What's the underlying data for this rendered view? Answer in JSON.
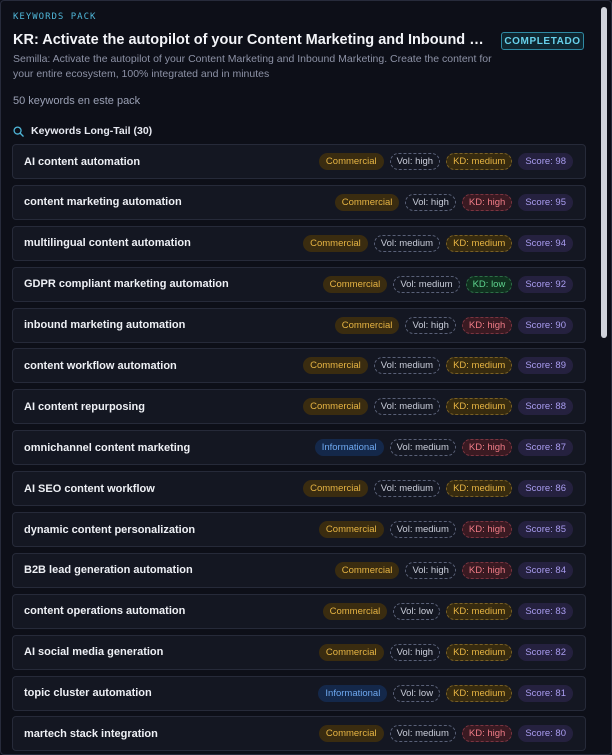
{
  "header": {
    "pack_label": "KEYWORDS PACK",
    "title": "KR: Activate the autopilot of your Content Marketing and Inbound Marketing. Create the content for your entire ecosystem, 100% integrated and in minutes",
    "status": "COMPLETADO",
    "description": "Semilla: Activate the autopilot of your Content Marketing and Inbound Marketing. Create the content for your entire ecosystem, 100% integrated and in minutes",
    "count_text": "50 keywords en este pack"
  },
  "section": {
    "icon": "search-icon",
    "title": "Keywords Long-Tail (30)"
  },
  "colors": {
    "accent": "#4fb6d8",
    "commercial": "#e6b443",
    "informational": "#6ea8f0",
    "kd_high": "#ef7b86",
    "kd_low": "#5ed48e",
    "score": "#a99cf0"
  },
  "keywords": [
    {
      "keyword": "AI content automation",
      "intent": "Commercial",
      "volume": "Vol: high",
      "kd": "KD: medium",
      "score": "Score: 98"
    },
    {
      "keyword": "content marketing automation",
      "intent": "Commercial",
      "volume": "Vol: high",
      "kd": "KD: high",
      "score": "Score: 95"
    },
    {
      "keyword": "multilingual content automation",
      "intent": "Commercial",
      "volume": "Vol: medium",
      "kd": "KD: medium",
      "score": "Score: 94"
    },
    {
      "keyword": "GDPR compliant marketing automation",
      "intent": "Commercial",
      "volume": "Vol: medium",
      "kd": "KD: low",
      "score": "Score: 92"
    },
    {
      "keyword": "inbound marketing automation",
      "intent": "Commercial",
      "volume": "Vol: high",
      "kd": "KD: high",
      "score": "Score: 90"
    },
    {
      "keyword": "content workflow automation",
      "intent": "Commercial",
      "volume": "Vol: medium",
      "kd": "KD: medium",
      "score": "Score: 89"
    },
    {
      "keyword": "AI content repurposing",
      "intent": "Commercial",
      "volume": "Vol: medium",
      "kd": "KD: medium",
      "score": "Score: 88"
    },
    {
      "keyword": "omnichannel content marketing",
      "intent": "Informational",
      "volume": "Vol: medium",
      "kd": "KD: high",
      "score": "Score: 87"
    },
    {
      "keyword": "AI SEO content workflow",
      "intent": "Commercial",
      "volume": "Vol: medium",
      "kd": "KD: medium",
      "score": "Score: 86"
    },
    {
      "keyword": "dynamic content personalization",
      "intent": "Commercial",
      "volume": "Vol: medium",
      "kd": "KD: high",
      "score": "Score: 85"
    },
    {
      "keyword": "B2B lead generation automation",
      "intent": "Commercial",
      "volume": "Vol: high",
      "kd": "KD: high",
      "score": "Score: 84"
    },
    {
      "keyword": "content operations automation",
      "intent": "Commercial",
      "volume": "Vol: low",
      "kd": "KD: medium",
      "score": "Score: 83"
    },
    {
      "keyword": "AI social media generation",
      "intent": "Commercial",
      "volume": "Vol: high",
      "kd": "KD: medium",
      "score": "Score: 82"
    },
    {
      "keyword": "topic cluster automation",
      "intent": "Informational",
      "volume": "Vol: low",
      "kd": "KD: medium",
      "score": "Score: 81"
    },
    {
      "keyword": "martech stack integration",
      "intent": "Commercial",
      "volume": "Vol: medium",
      "kd": "KD: high",
      "score": "Score: 80"
    }
  ]
}
